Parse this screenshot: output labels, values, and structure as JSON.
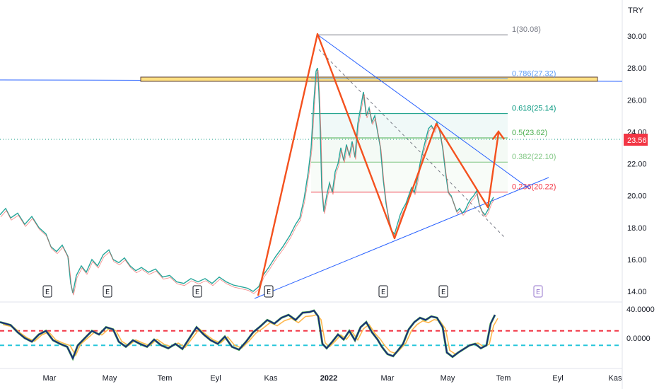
{
  "chart_data": {
    "type": "candlestick",
    "currency": "TRY",
    "last_price": "23.56",
    "y_ticks": [
      "30.00",
      "28.00",
      "26.00",
      "24.00",
      "22.00",
      "20.00",
      "18.00",
      "16.00",
      "14.00"
    ],
    "x_ticks": [
      "Mar",
      "May",
      "Tem",
      "Eyl",
      "Kas",
      "2022",
      "Mar",
      "May",
      "Tem",
      "Eyl",
      "Kas"
    ],
    "ylim": [
      13.5,
      31.0
    ],
    "fibonacci": [
      {
        "label": "1(30.08)",
        "value": 30.08,
        "color": "#787b86"
      },
      {
        "label": "0.786(27.32)",
        "value": 27.32,
        "color": "#5b9cf6"
      },
      {
        "label": "0.618(25.14)",
        "value": 25.14,
        "color": "#089981"
      },
      {
        "label": "0.5(23.62)",
        "value": 23.62,
        "color": "#4caf50"
      },
      {
        "label": "0.382(22.10)",
        "value": 22.1,
        "color": "#81c784"
      },
      {
        "label": "0.236(20.22)",
        "value": 20.22,
        "color": "#f23645"
      }
    ],
    "earnings_markers": [
      "E",
      "E",
      "E",
      "E",
      "E",
      "E",
      "E"
    ],
    "price_series": [
      [
        0,
        18.8
      ],
      [
        8,
        19.2
      ],
      [
        15,
        18.6
      ],
      [
        25,
        18.9
      ],
      [
        35,
        18.2
      ],
      [
        45,
        18.7
      ],
      [
        55,
        18.0
      ],
      [
        65,
        17.6
      ],
      [
        72,
        16.8
      ],
      [
        80,
        16.5
      ],
      [
        88,
        16.9
      ],
      [
        96,
        16.2
      ],
      [
        100,
        14.5
      ],
      [
        103,
        13.9
      ],
      [
        108,
        15.0
      ],
      [
        115,
        15.6
      ],
      [
        122,
        15.2
      ],
      [
        130,
        16.0
      ],
      [
        138,
        15.6
      ],
      [
        146,
        16.3
      ],
      [
        154,
        16.6
      ],
      [
        160,
        16.0
      ],
      [
        168,
        15.8
      ],
      [
        176,
        16.1
      ],
      [
        184,
        15.6
      ],
      [
        192,
        15.3
      ],
      [
        200,
        15.5
      ],
      [
        210,
        15.2
      ],
      [
        220,
        15.4
      ],
      [
        230,
        14.9
      ],
      [
        240,
        15.0
      ],
      [
        250,
        14.6
      ],
      [
        260,
        14.5
      ],
      [
        270,
        14.8
      ],
      [
        280,
        14.6
      ],
      [
        290,
        14.8
      ],
      [
        300,
        14.5
      ],
      [
        310,
        14.9
      ],
      [
        320,
        14.6
      ],
      [
        330,
        14.4
      ],
      [
        340,
        14.3
      ],
      [
        350,
        14.2
      ],
      [
        358,
        14.0
      ],
      [
        366,
        14.3
      ],
      [
        372,
        15.0
      ],
      [
        380,
        15.5
      ],
      [
        390,
        16.2
      ],
      [
        400,
        16.8
      ],
      [
        410,
        17.5
      ],
      [
        418,
        18.2
      ],
      [
        424,
        18.6
      ],
      [
        430,
        19.8
      ],
      [
        436,
        21.5
      ],
      [
        440,
        23.0
      ],
      [
        444,
        26.0
      ],
      [
        447,
        27.8
      ],
      [
        449,
        28.0
      ],
      [
        451,
        26.5
      ],
      [
        453,
        24.0
      ],
      [
        455,
        20.5
      ],
      [
        458,
        19.0
      ],
      [
        462,
        20.0
      ],
      [
        466,
        20.8
      ],
      [
        470,
        20.2
      ],
      [
        474,
        21.5
      ],
      [
        478,
        22.0
      ],
      [
        482,
        23.0
      ],
      [
        486,
        22.2
      ],
      [
        490,
        23.2
      ],
      [
        494,
        22.5
      ],
      [
        498,
        23.4
      ],
      [
        502,
        22.4
      ],
      [
        506,
        24.5
      ],
      [
        510,
        25.5
      ],
      [
        514,
        26.5
      ],
      [
        518,
        25.0
      ],
      [
        522,
        25.5
      ],
      [
        526,
        24.6
      ],
      [
        530,
        25.0
      ],
      [
        534,
        24.0
      ],
      [
        538,
        23.0
      ],
      [
        542,
        21.0
      ],
      [
        546,
        19.5
      ],
      [
        550,
        18.5
      ],
      [
        554,
        17.8
      ],
      [
        558,
        17.6
      ],
      [
        562,
        18.2
      ],
      [
        566,
        18.8
      ],
      [
        570,
        19.2
      ],
      [
        574,
        19.5
      ],
      [
        578,
        20.0
      ],
      [
        582,
        20.5
      ],
      [
        586,
        20.2
      ],
      [
        590,
        21.0
      ],
      [
        594,
        22.0
      ],
      [
        598,
        22.8
      ],
      [
        602,
        23.5
      ],
      [
        606,
        24.2
      ],
      [
        610,
        24.4
      ],
      [
        614,
        24.1
      ],
      [
        618,
        24.6
      ],
      [
        622,
        24.0
      ],
      [
        626,
        23.0
      ],
      [
        630,
        21.5
      ],
      [
        634,
        20.2
      ],
      [
        638,
        20.0
      ],
      [
        642,
        19.5
      ],
      [
        646,
        19.0
      ],
      [
        650,
        19.2
      ],
      [
        654,
        18.9
      ],
      [
        658,
        19.1
      ],
      [
        662,
        19.5
      ],
      [
        666,
        19.8
      ],
      [
        670,
        20.0
      ],
      [
        674,
        20.3
      ],
      [
        678,
        19.4
      ],
      [
        682,
        19.0
      ],
      [
        686,
        18.8
      ],
      [
        690,
        19.1
      ],
      [
        694,
        19.6
      ],
      [
        698,
        19.9
      ]
    ],
    "oscillator": {
      "y_ticks": [
        "40.0000",
        "0.0000"
      ],
      "upper_level": 10,
      "lower_level": -10,
      "ylim": [
        -35,
        42
      ],
      "series": [
        [
          0,
          22
        ],
        [
          15,
          18
        ],
        [
          25,
          8
        ],
        [
          35,
          0
        ],
        [
          45,
          -5
        ],
        [
          55,
          5
        ],
        [
          65,
          10
        ],
        [
          75,
          -3
        ],
        [
          85,
          -8
        ],
        [
          95,
          -12
        ],
        [
          103,
          -28
        ],
        [
          110,
          -10
        ],
        [
          120,
          0
        ],
        [
          130,
          10
        ],
        [
          140,
          5
        ],
        [
          150,
          15
        ],
        [
          160,
          12
        ],
        [
          168,
          -5
        ],
        [
          178,
          -12
        ],
        [
          188,
          -3
        ],
        [
          198,
          -8
        ],
        [
          208,
          -12
        ],
        [
          218,
          -2
        ],
        [
          228,
          -10
        ],
        [
          238,
          -14
        ],
        [
          248,
          -8
        ],
        [
          258,
          -15
        ],
        [
          268,
          0
        ],
        [
          278,
          15
        ],
        [
          288,
          5
        ],
        [
          298,
          -3
        ],
        [
          308,
          -8
        ],
        [
          318,
          2
        ],
        [
          328,
          -12
        ],
        [
          338,
          -16
        ],
        [
          348,
          -5
        ],
        [
          358,
          8
        ],
        [
          368,
          16
        ],
        [
          378,
          25
        ],
        [
          388,
          20
        ],
        [
          398,
          28
        ],
        [
          408,
          32
        ],
        [
          418,
          25
        ],
        [
          428,
          35
        ],
        [
          438,
          36
        ],
        [
          444,
          38
        ],
        [
          450,
          30
        ],
        [
          456,
          -8
        ],
        [
          462,
          -14
        ],
        [
          470,
          -5
        ],
        [
          478,
          5
        ],
        [
          486,
          -2
        ],
        [
          494,
          10
        ],
        [
          502,
          -3
        ],
        [
          510,
          15
        ],
        [
          518,
          22
        ],
        [
          526,
          8
        ],
        [
          534,
          -2
        ],
        [
          540,
          -12
        ],
        [
          548,
          -22
        ],
        [
          556,
          -25
        ],
        [
          562,
          -18
        ],
        [
          570,
          -8
        ],
        [
          578,
          12
        ],
        [
          586,
          22
        ],
        [
          594,
          28
        ],
        [
          602,
          25
        ],
        [
          610,
          30
        ],
        [
          618,
          28
        ],
        [
          626,
          15
        ],
        [
          632,
          -20
        ],
        [
          640,
          -26
        ],
        [
          648,
          -20
        ],
        [
          656,
          -15
        ],
        [
          664,
          -10
        ],
        [
          672,
          -8
        ],
        [
          680,
          -14
        ],
        [
          688,
          -10
        ],
        [
          694,
          20
        ],
        [
          700,
          32
        ]
      ]
    }
  }
}
